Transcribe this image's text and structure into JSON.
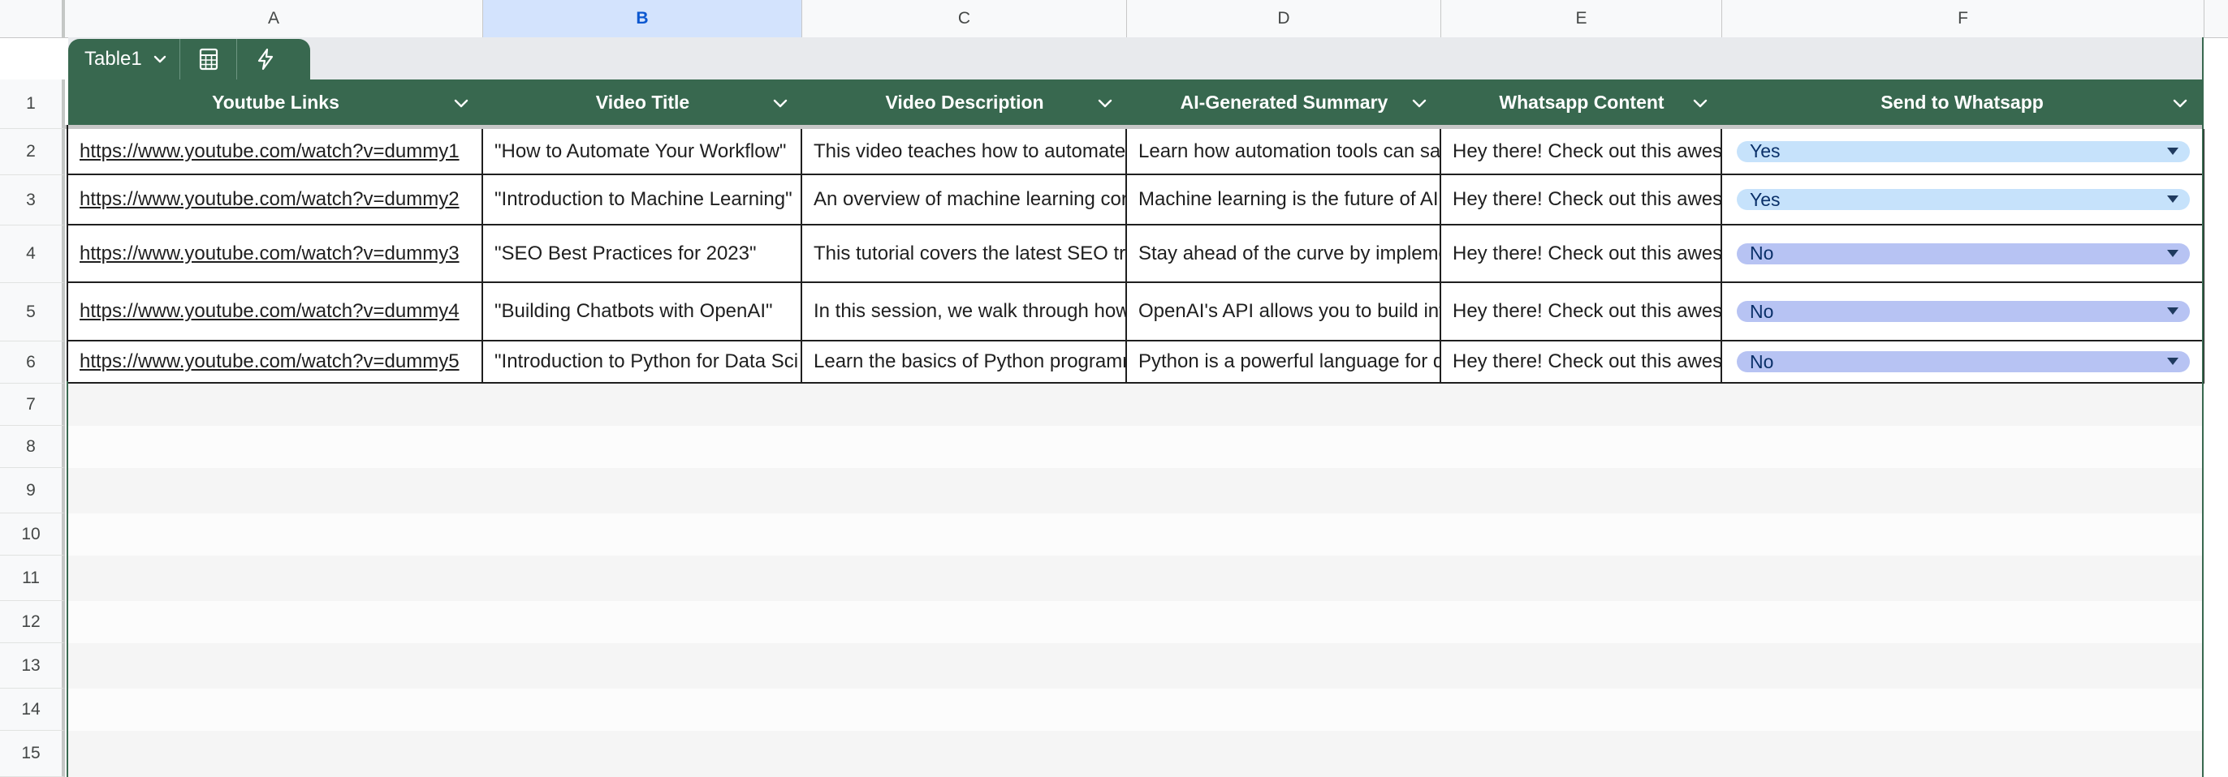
{
  "column_letters": [
    "A",
    "B",
    "C",
    "D",
    "E",
    "F"
  ],
  "selected_column": "B",
  "table_tab": {
    "name": "Table1",
    "chevron_icon": "chevron-down-icon",
    "buttons": [
      "calculator-icon",
      "lightning-icon"
    ]
  },
  "colors": {
    "table_header": "#38684f",
    "chip_yes": "#c6e2fb",
    "chip_no": "#b7c3f3",
    "selected_column_bg": "#d3e3fd"
  },
  "headers": [
    "Youtube Links",
    "Video Title",
    "Video Description",
    "AI-Generated Summary",
    "Whatsapp Content",
    "Send to Whatsapp"
  ],
  "row_numbers": [
    "1",
    "2",
    "3",
    "4",
    "5",
    "6",
    "7",
    "8",
    "9",
    "10",
    "11",
    "12",
    "13",
    "14",
    "15"
  ],
  "rows": [
    {
      "link": "https://www.youtube.com/watch?v=dummy1",
      "title": "\"How to Automate Your Workflow\"",
      "description": "This video teaches how to automate",
      "summary": "Learn how automation tools can sa",
      "whatsapp": "Hey there! Check out this awes",
      "send": "Yes"
    },
    {
      "link": "https://www.youtube.com/watch?v=dummy2",
      "title": "\"Introduction to Machine Learning\"",
      "description": "An overview of machine learning cor",
      "summary": "Machine learning is the future of AI",
      "whatsapp": "Hey there! Check out this awes",
      "send": "Yes"
    },
    {
      "link": "https://www.youtube.com/watch?v=dummy3",
      "title": "\"SEO Best Practices for 2023\"",
      "description": "This tutorial covers the latest SEO tr",
      "summary": "Stay ahead of the curve by impleme",
      "whatsapp": "Hey there! Check out this awes",
      "send": "No"
    },
    {
      "link": "https://www.youtube.com/watch?v=dummy4",
      "title": "\"Building Chatbots with OpenAI\"",
      "description": "In this session, we walk through how",
      "summary": "OpenAI's API allows you to build int",
      "whatsapp": "Hey there! Check out this awes",
      "send": "No"
    },
    {
      "link": "https://www.youtube.com/watch?v=dummy5",
      "title": "\"Introduction to Python for Data Sci",
      "description": "Learn the basics of Python programm",
      "summary": "Python is a powerful language for d",
      "whatsapp": "Hey there! Check out this awes",
      "send": "No"
    }
  ]
}
